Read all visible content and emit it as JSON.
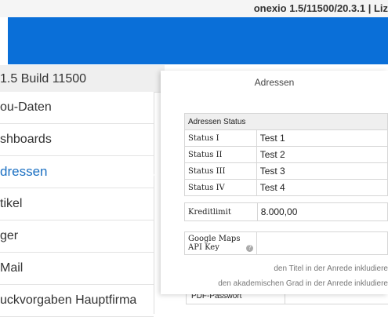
{
  "top_bar": {
    "version_text": "onexio 1.5/11500/20.3.1 | Liz"
  },
  "brand": {
    "banner_color": "#0a6fd8"
  },
  "sidebar": {
    "build_header": "1.5 Build 11500",
    "items": [
      {
        "label": "ou-Daten"
      },
      {
        "label": "shboards"
      },
      {
        "label": "dressen",
        "active": true
      },
      {
        "label": "tikel"
      },
      {
        "label": "ger"
      },
      {
        "label": "Mail"
      },
      {
        "label": "uckvorgaben Hauptfirma"
      }
    ]
  },
  "panel": {
    "title": "Adressen",
    "status_header": "Adressen Status",
    "statuses": [
      {
        "label": "Status I",
        "value": "Test 1"
      },
      {
        "label": "Status II",
        "value": "Test 2"
      },
      {
        "label": "Status III",
        "value": "Test 3"
      },
      {
        "label": "Status IV",
        "value": "Test 4"
      }
    ],
    "credit_label": "Kreditlimit",
    "credit_value": "8.000,00",
    "maps_label": "Google Maps API Key",
    "maps_value": "",
    "note_title": "den Titel in der Anrede inkludiere",
    "note_grade": "den akademischen Grad in der Anrede inkludiere"
  },
  "underlying": {
    "pdf_password_label": "PDF-Passwort"
  }
}
